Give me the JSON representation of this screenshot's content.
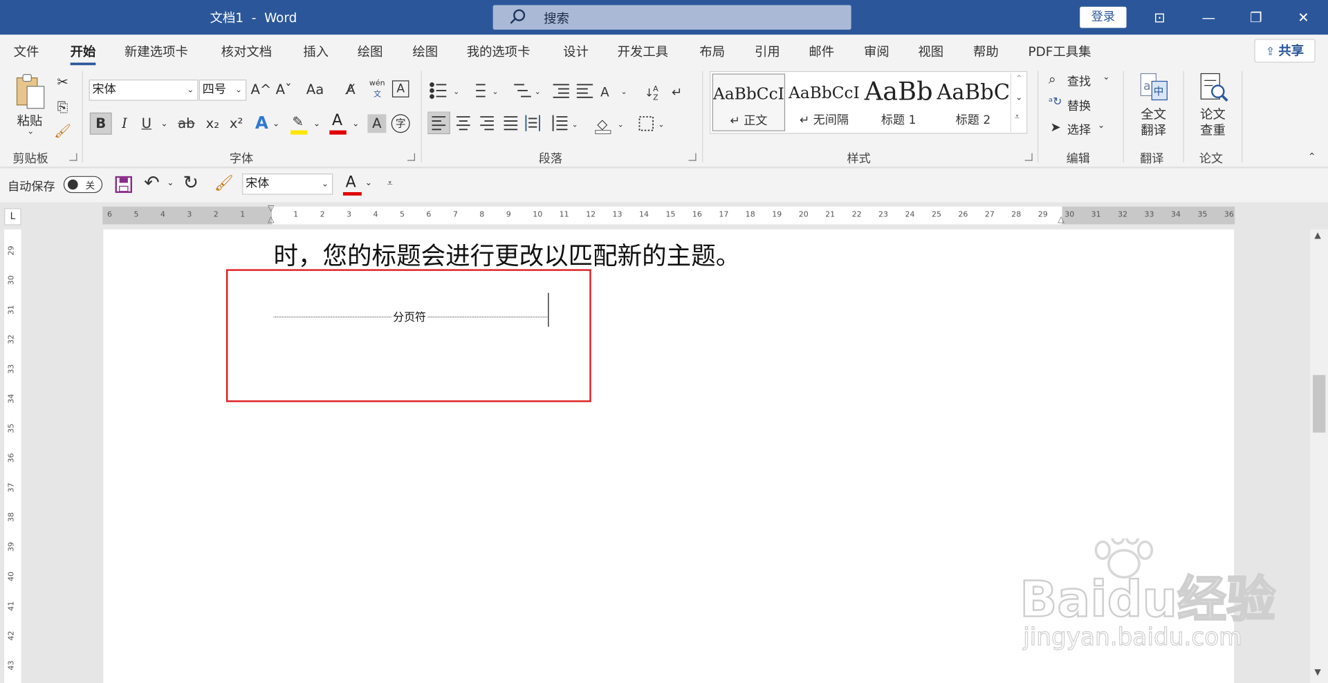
{
  "titlebar": {
    "doc_title": "文档1  -  Word",
    "search_label": "搜索",
    "login": "登录",
    "btn_ribbon": "⊡",
    "btn_min": "—",
    "btn_restore": "❐",
    "btn_close": "✕"
  },
  "menu": {
    "tabs": [
      "文件",
      "开始",
      "新建选项卡",
      "核对文档",
      "插入",
      "绘图",
      "绘图",
      "我的选项卡",
      "设计",
      "开发工具",
      "布局",
      "引用",
      "邮件",
      "审阅",
      "视图",
      "帮助",
      "PDF工具集"
    ],
    "active": "开始",
    "share": "共享"
  },
  "ribbon": {
    "clipboard": {
      "paste": "粘贴",
      "label": "剪贴板"
    },
    "font": {
      "name": "宋体",
      "size": "四号",
      "label": "字体",
      "bold": "B",
      "italic": "I",
      "underline": "U",
      "strike": "ab",
      "subscript": "x₂",
      "superscript": "x²",
      "grow": "A^",
      "shrink": "Aˇ",
      "case": "Aa",
      "phonetic_top": "wén",
      "phonetic_bottom": "文",
      "border_char": "A",
      "circle_char": "字",
      "shade_char": "A",
      "font_color_char": "A",
      "effect_char": "A"
    },
    "paragraph": {
      "label": "段落"
    },
    "styles": {
      "label": "样式",
      "items": [
        {
          "sample": "AaBbCcI",
          "name": "↵ 正文"
        },
        {
          "sample": "AaBbCcI",
          "name": "↵ 无间隔"
        },
        {
          "sample": "AaBb",
          "name": "标题 1"
        },
        {
          "sample": "AaBbC",
          "name": "标题 2"
        }
      ]
    },
    "editing": {
      "find": "查找",
      "replace": "替换",
      "select": "选择",
      "label": "编辑"
    },
    "translate": {
      "btn_line1": "全文",
      "btn_line2": "翻译",
      "label": "翻译"
    },
    "paper": {
      "btn_line1": "论文",
      "btn_line2": "查重",
      "label": "论文"
    }
  },
  "qat": {
    "autosave": "自动保存",
    "autosave_state": "关",
    "font": "宋体",
    "font_color_char": "A"
  },
  "ruler": {
    "h_ticks": [
      "6",
      "5",
      "4",
      "3",
      "2",
      "1",
      "1",
      "2",
      "3",
      "4",
      "5",
      "6",
      "7",
      "8",
      "9",
      "10",
      "11",
      "12",
      "13",
      "14",
      "15",
      "16",
      "17",
      "18",
      "19",
      "20",
      "21",
      "22",
      "23",
      "24",
      "25",
      "26",
      "27",
      "28",
      "29",
      "30",
      "31",
      "32",
      "33",
      "34",
      "35",
      "36"
    ],
    "v_ticks": [
      "29",
      "30",
      "31",
      "32",
      "33",
      "34",
      "35",
      "36",
      "37",
      "38",
      "39",
      "40",
      "41",
      "42",
      "43"
    ],
    "corner": "L"
  },
  "document": {
    "text_line": "时，您的标题会进行更改以匹配新的主题。",
    "page_break_label": "分页符"
  },
  "watermark": {
    "line1": "Baidu经验",
    "line2": "jingyan.baidu.com"
  },
  "colors": {
    "title_bar": "#2b579a",
    "highlight_box": "#e02020",
    "highlight_yellow": "#ffe600",
    "font_red": "#e00000"
  }
}
